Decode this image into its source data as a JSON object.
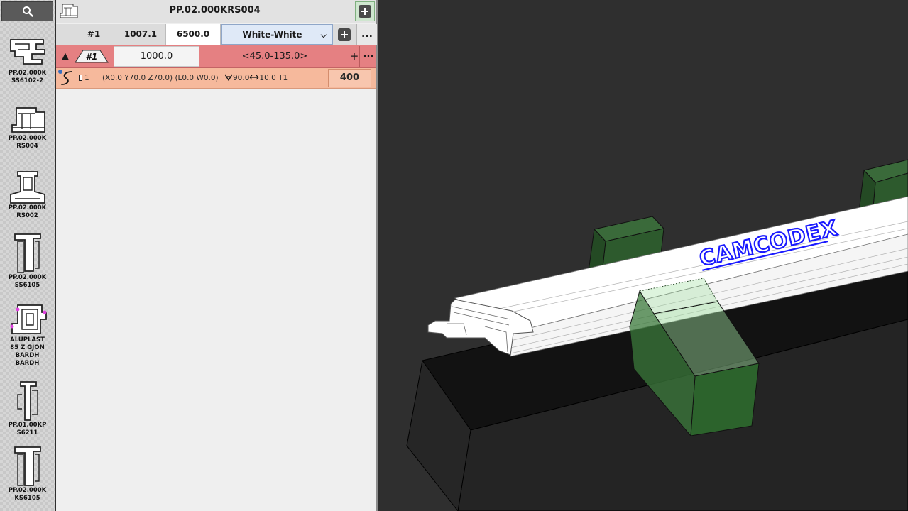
{
  "sidebar": {
    "search_icon": "search-icon",
    "items": [
      {
        "label": "PP.02.000K\nSS6102-2"
      },
      {
        "label": "PP.02.000K\nRS004"
      },
      {
        "label": "PP.02.000K\nRS002"
      },
      {
        "label": "PP.02.000K\nSS6105"
      },
      {
        "label": "ALUPLAST\n85 Z GJON\nBARDH\nBARDH"
      },
      {
        "label": "PP.01.00KP\nS6211"
      },
      {
        "label": "PP.02.000K\nKS6105"
      }
    ]
  },
  "header": {
    "title": "PP.02.000KRS004",
    "add_icon": "plus-square-icon"
  },
  "bar": {
    "index": "#1",
    "length": "1007.1",
    "stock_length": "6500.0",
    "color": "White-White",
    "more": "..."
  },
  "cut": {
    "collapse": "▲",
    "tag": "#1",
    "length": "1000.0",
    "angle_range": "<45.0-135.0>",
    "add": "+",
    "more": "..."
  },
  "operation": {
    "tool_count": "1",
    "coords": "(X0.0 Y70.0 Z70.0) (L0.0 W0.0)",
    "angle": "90.0",
    "offset": "10.0 T1",
    "speed": "400"
  },
  "viewport": {
    "engraving_text": "CAMCODEX",
    "colors": {
      "background": "#2f2f2f",
      "table": "#1e1e1e",
      "clamps": "#2e5a2e",
      "profile": "#ffffff",
      "engraving": "#1a1aff"
    }
  }
}
